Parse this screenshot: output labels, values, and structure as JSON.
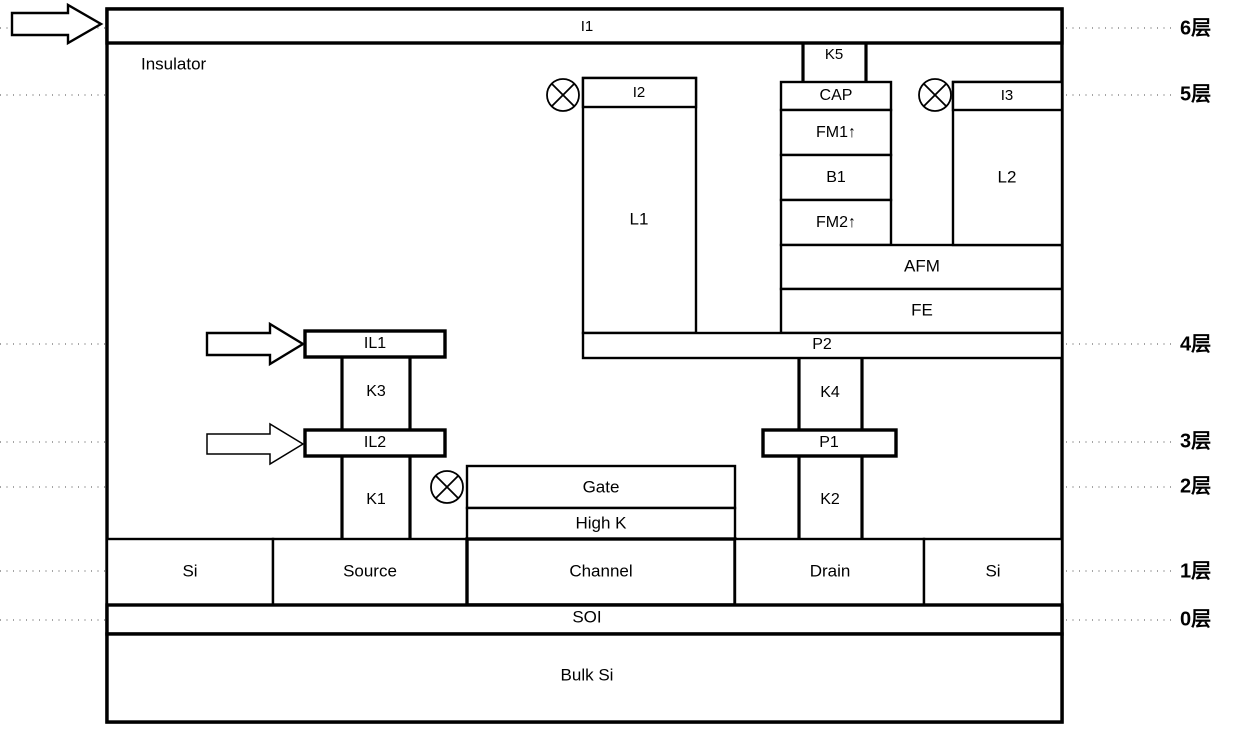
{
  "diagram": {
    "title_text": "Insulator",
    "layer_axis": {
      "labels": [
        {
          "name": "layer-6",
          "text": "6层"
        },
        {
          "name": "layer-5",
          "text": "5层"
        },
        {
          "name": "layer-4",
          "text": "4层"
        },
        {
          "name": "layer-3",
          "text": "3层"
        },
        {
          "name": "layer-2",
          "text": "2层"
        },
        {
          "name": "layer-1",
          "text": "1层"
        },
        {
          "name": "layer-0",
          "text": "0层"
        }
      ]
    },
    "blocks": {
      "i1": "I1",
      "i2": "I2",
      "i3": "I3",
      "k5": "K5",
      "k4": "K4",
      "k3": "K3",
      "k2": "K2",
      "k1": "K1",
      "cap": "CAP",
      "fm1": "FM1↑",
      "b1": "B1",
      "fm2": "FM2↑",
      "afm": "AFM",
      "fe": "FE",
      "l1": "L1",
      "l2": "L2",
      "p1": "P1",
      "p2": "P2",
      "il1": "IL1",
      "il2": "IL2",
      "gate": "Gate",
      "high_k": "High K",
      "si_left": "Si",
      "source": "Source",
      "channel": "Channel",
      "drain": "Drain",
      "si_right": "Si",
      "soi": "SOI",
      "bulk_si": "Bulk Si"
    },
    "colors": {
      "stroke": "#000000",
      "fill": "#ffffff",
      "dashed_guide": "#4a4a4a"
    }
  }
}
